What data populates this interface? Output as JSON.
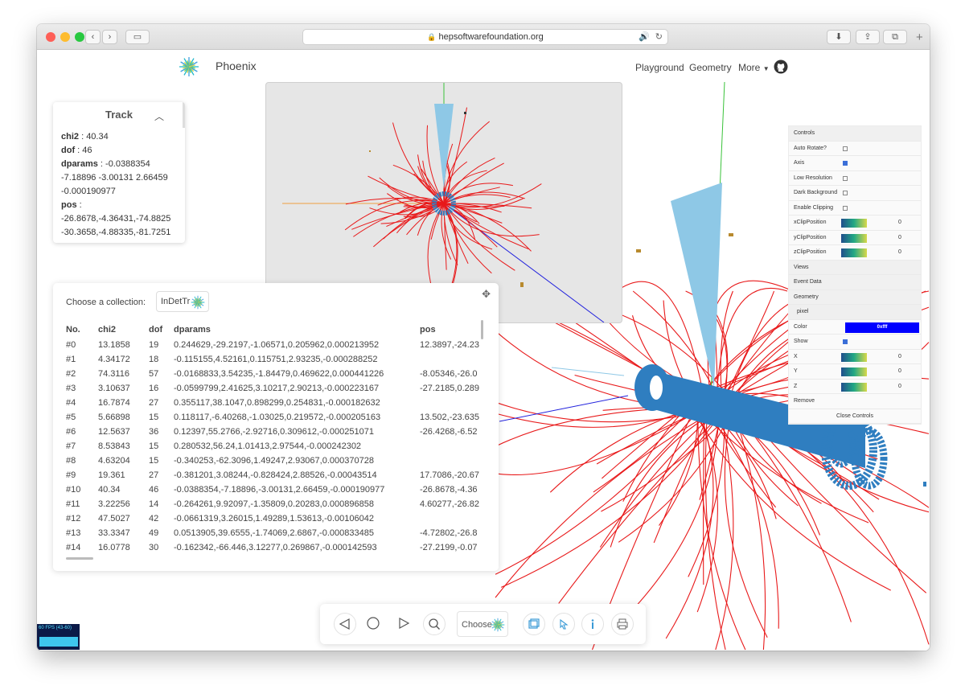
{
  "browser": {
    "url": "hepsoftwarefoundation.org"
  },
  "header": {
    "brand": "Phoenix",
    "nav": [
      "Playground",
      "Geometry",
      "More"
    ]
  },
  "track_panel": {
    "title": "Track",
    "lines": [
      {
        "key": "chi2",
        "sep": " : ",
        "value": "40.34"
      },
      {
        "key": "dof",
        "sep": " : ",
        "value": "46"
      },
      {
        "key": "dparams",
        "sep": " : ",
        "value": "-0.0388354"
      },
      {
        "key": "",
        "sep": "",
        "value": "-7.18896 -3.00131 2.66459"
      },
      {
        "key": "",
        "sep": "",
        "value": "-0.000190977"
      },
      {
        "key": "pos",
        "sep": " :",
        "value": ""
      },
      {
        "key": "",
        "sep": "",
        "value": "-26.8678,-4.36431,-74.8825"
      },
      {
        "key": "",
        "sep": "",
        "value": "-30.3658,-4.88335,-81.7251"
      }
    ]
  },
  "collection_panel": {
    "label": "Choose a collection:",
    "selected": "InDetTr",
    "columns": [
      "No.",
      "chi2",
      "dof",
      "dparams",
      "pos"
    ],
    "rows": [
      [
        "#0",
        "13.1858",
        "19",
        "0.244629,-29.2197,-1.06571,0.205962,0.000213952",
        "12.3897,-24.23"
      ],
      [
        "#1",
        "4.34172",
        "18",
        "-0.115155,4.52161,0.115751,2.93235,-0.000288252",
        ""
      ],
      [
        "#2",
        "74.3116",
        "57",
        "-0.0168833,3.54235,-1.84479,0.469622,0.000441226",
        "-8.05346,-26.0"
      ],
      [
        "#3",
        "3.10637",
        "16",
        "-0.0599799,2.41625,3.10217,2.90213,-0.000223167",
        "-27.2185,0.289"
      ],
      [
        "#4",
        "16.7874",
        "27",
        "0.355117,38.1047,0.898299,0.254831,-0.000182632",
        ""
      ],
      [
        "#5",
        "5.66898",
        "15",
        "0.118117,-6.40268,-1.03025,0.219572,-0.000205163",
        "13.502,-23.635"
      ],
      [
        "#6",
        "12.5637",
        "36",
        "0.12397,55.2766,-2.92716,0.309612,-0.000251071",
        "-26.4268,-6.52"
      ],
      [
        "#7",
        "8.53843",
        "15",
        "0.280532,56.24,1.01413,2.97544,-0.000242302",
        ""
      ],
      [
        "#8",
        "4.63204",
        "15",
        "-0.340253,-62.3096,1.49247,2.93067,0.000370728",
        ""
      ],
      [
        "#9",
        "19.361",
        "27",
        "-0.381201,3.08244,-0.828424,2.88526,-0.00043514",
        "17.7086,-20.67"
      ],
      [
        "#10",
        "40.34",
        "46",
        "-0.0388354,-7.18896,-3.00131,2.66459,-0.000190977",
        "-26.8678,-4.36"
      ],
      [
        "#11",
        "3.22256",
        "14",
        "-0.264261,9.92097,-1.35809,0.20283,0.000896858",
        "4.60277,-26.82"
      ],
      [
        "#12",
        "47.5027",
        "42",
        "-0.0661319,3.26015,1.49289,1.53613,-0.00106042",
        ""
      ],
      [
        "#13",
        "33.3347",
        "49",
        "0.0513905,39.6555,-1.74069,2.6867,-0.000833485",
        "-4.72802,-26.8"
      ],
      [
        "#14",
        "16.0778",
        "30",
        "-0.162342,-66.446,3.12277,0.269867,-0.000142593",
        "-27.2199,-0.07"
      ]
    ]
  },
  "controls": {
    "title": "Controls",
    "auto_rotate": "Auto Rotate?",
    "axis": "Axis",
    "low_res": "Low Resolution",
    "dark_bg": "Dark Background",
    "clipping": "Enable Clipping",
    "x_clip": "xClipPosition",
    "y_clip": "yClipPosition",
    "z_clip": "zClipPosition",
    "clip_value": "0",
    "views": "Views",
    "event_data": "Event Data",
    "geometry": "Geometry",
    "pixel": "pixel",
    "color_label": "Color",
    "color_value": "0xfff",
    "show": "Show",
    "x": "X",
    "y": "Y",
    "z": "Z",
    "remove": "Remove",
    "close": "Close Controls"
  },
  "toolbar": {
    "choose": "Choose"
  },
  "fps": "60 FPS (43-60)",
  "colors": {
    "track": "#e8191a",
    "detector": "#2f7ec0",
    "cone": "#8ec8e6",
    "axis_green": "#39c239",
    "axis_blue": "#2222dd",
    "axis_orange": "#f0a040"
  }
}
